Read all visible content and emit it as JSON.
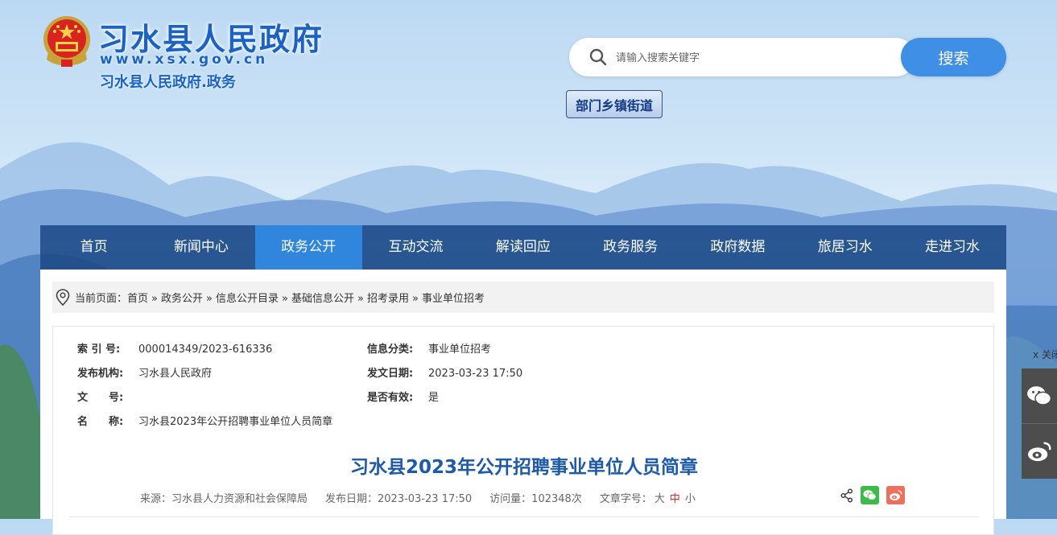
{
  "header": {
    "site_title": "习水县人民政府",
    "site_url": "www.xsx.gov.cn",
    "site_sub": "习水县人民政府.政务"
  },
  "search": {
    "placeholder": "请输入搜索关键字",
    "button": "搜索"
  },
  "dept_button": "部门乡镇街道",
  "nav": {
    "items": [
      "首页",
      "新闻中心",
      "政务公开",
      "互动交流",
      "解读回应",
      "政务服务",
      "政府数据",
      "旅居习水",
      "走进习水"
    ],
    "active": "政务公开"
  },
  "breadcrumb": {
    "prefix": "当前页面：",
    "items": [
      "首页",
      "政务公开",
      "信息公开目录",
      "基础信息公开",
      "招考录用",
      "事业单位招考"
    ],
    "separator": "»"
  },
  "meta": {
    "index_label": "索 引 号:",
    "index_value": "000014349/2023-616336",
    "category_label": "信息分类:",
    "category_value": "事业单位招考",
    "org_label": "发布机构:",
    "org_value": "习水县人民政府",
    "date_label": "发文日期:",
    "date_value": "2023-03-23 17:50",
    "doc_label": "文　　号:",
    "doc_value": "",
    "valid_label": "是否有效:",
    "valid_value": "是",
    "name_label": "名　　称:",
    "name_value": "习水县2023年公开招聘事业单位人员简章"
  },
  "article": {
    "title": "习水县2023年公开招聘事业单位人员简章",
    "source": "来源：习水县人力资源和社会保障局",
    "publish": "发布日期：2023-03-23 17:50",
    "visits": "访问量：102348次",
    "font_label": "文章字号：",
    "font_large": "大",
    "font_mid": "中",
    "font_small": "小"
  },
  "float": {
    "close_label": "x 关闭"
  },
  "colors": {
    "brand_blue": "#1b62c4",
    "nav_active": "#2f86dc",
    "title_blue": "#1e5aa8",
    "font_mid_red": "#e4242d",
    "wechat_green": "#3dbb4a",
    "weibo_red": "#ee6f5b"
  },
  "icons": [
    "national-emblem-icon",
    "search-icon",
    "location-pin-icon",
    "share-icon",
    "wechat-icon",
    "weibo-icon"
  ]
}
